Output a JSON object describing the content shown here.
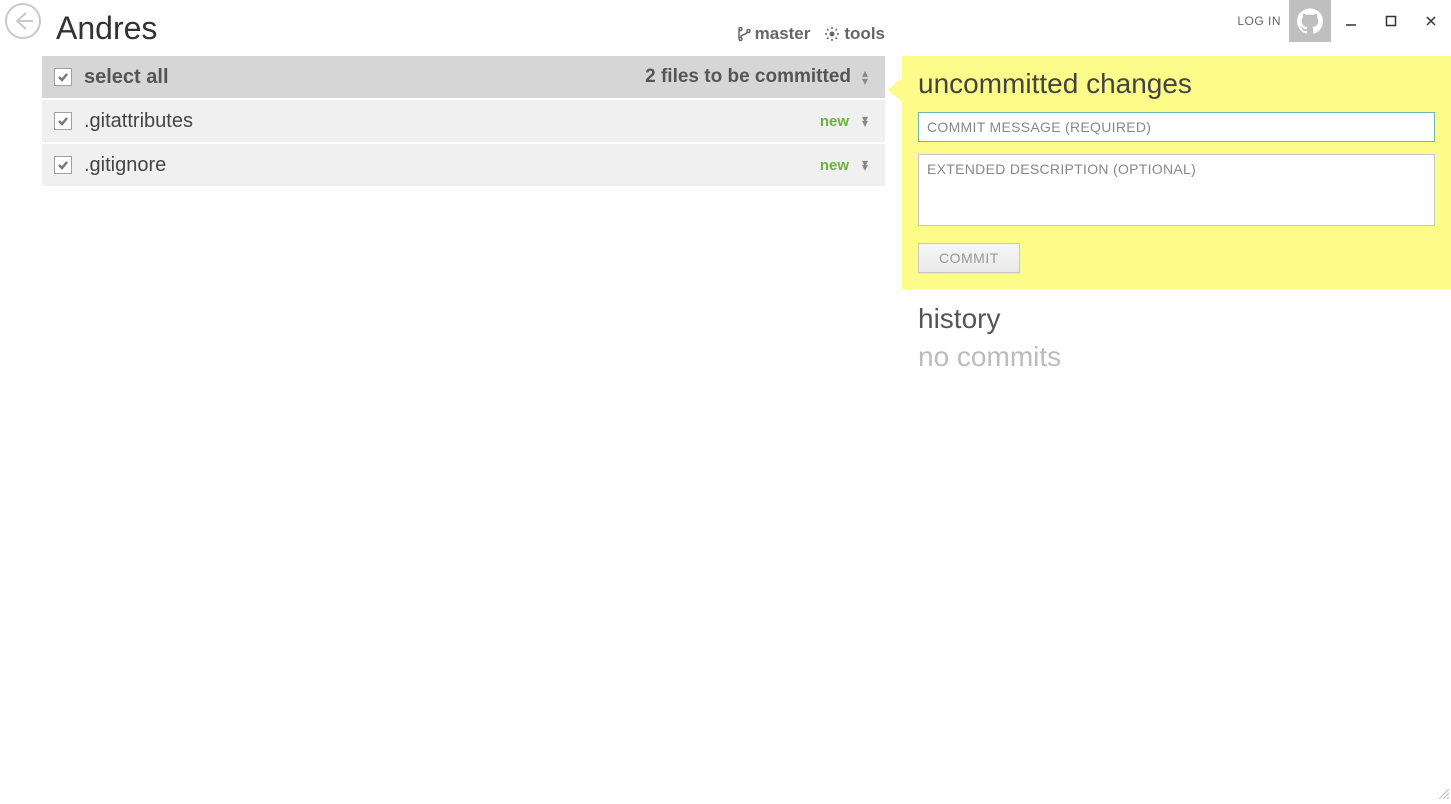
{
  "header": {
    "login": "LOG IN",
    "repo_name": "Andres",
    "branch": "master",
    "tools": "tools"
  },
  "files": {
    "select_all": "select all",
    "count_label": "2 files to be committed",
    "rows": [
      {
        "name": ".gitattributes",
        "status": "new"
      },
      {
        "name": ".gitignore",
        "status": "new"
      }
    ]
  },
  "commit_panel": {
    "title": "uncommitted changes",
    "message_placeholder": "COMMIT MESSAGE (REQUIRED)",
    "description_placeholder": "EXTENDED DESCRIPTION (OPTIONAL)",
    "button": "COMMIT"
  },
  "history": {
    "title": "history",
    "empty": "no commits"
  }
}
